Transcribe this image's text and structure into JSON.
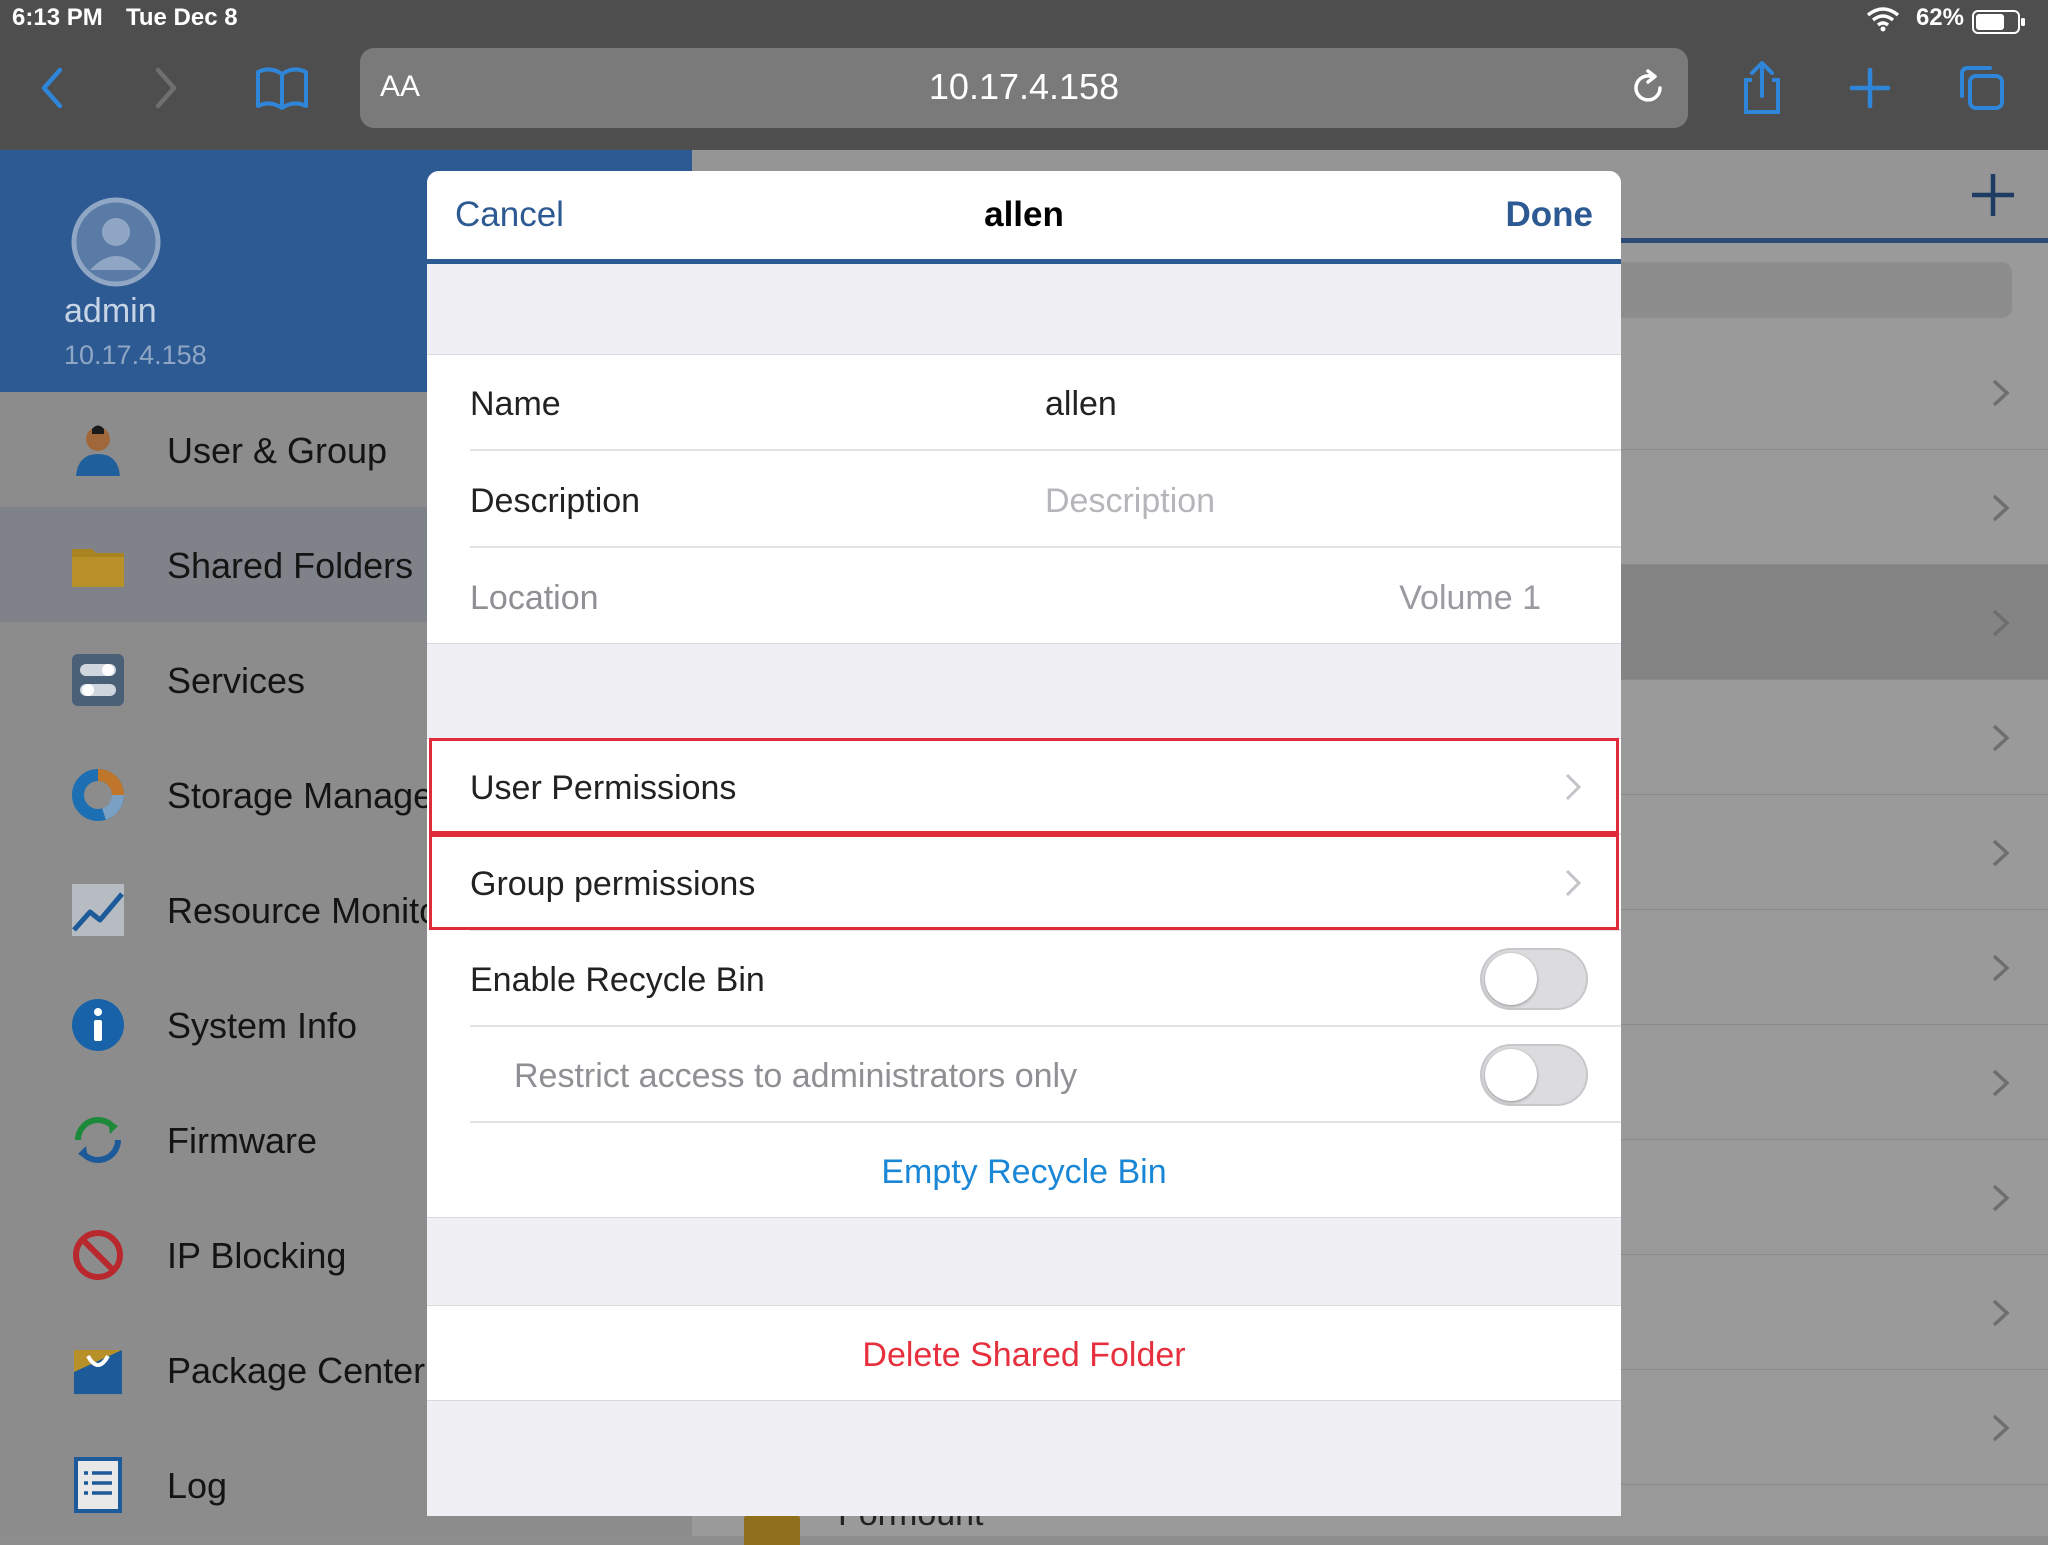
{
  "status_bar": {
    "time": "6:13 PM",
    "date": "Tue Dec 8",
    "battery": "62%"
  },
  "browser": {
    "aa_label": "AA",
    "url": "10.17.4.158"
  },
  "profile": {
    "name": "admin",
    "ip": "10.17.4.158"
  },
  "sidebar": {
    "items": [
      {
        "label": "User & Group",
        "icon": "user-icon"
      },
      {
        "label": "Shared Folders",
        "icon": "folder-icon"
      },
      {
        "label": "Services",
        "icon": "toggles-icon"
      },
      {
        "label": "Storage Manager",
        "icon": "storage-ring-icon"
      },
      {
        "label": "Resource Monitor",
        "icon": "chart-line-icon"
      },
      {
        "label": "System Info",
        "icon": "info-icon"
      },
      {
        "label": "Firmware",
        "icon": "refresh-icon"
      },
      {
        "label": "IP Blocking",
        "icon": "block-icon"
      },
      {
        "label": "Package Center",
        "icon": "package-icon"
      },
      {
        "label": "Log",
        "icon": "log-list-icon"
      }
    ],
    "active_index": 1
  },
  "right_list": {
    "last_item": "Formount"
  },
  "modal": {
    "cancel": "Cancel",
    "title": "allen",
    "done": "Done",
    "fields": {
      "name_label": "Name",
      "name_value": "allen",
      "description_label": "Description",
      "description_placeholder": "Description",
      "location_label": "Location",
      "location_value": "Volume 1"
    },
    "permissions": {
      "user": "User Permissions",
      "group": "Group permissions"
    },
    "recycle": {
      "enable_label": "Enable Recycle Bin",
      "enable_on": false,
      "restrict_label": "Restrict access to administrators only",
      "restrict_on": false,
      "empty_label": "Empty Recycle Bin"
    },
    "delete_label": "Delete Shared Folder"
  },
  "colors": {
    "accent": "#2d5a93",
    "link": "#1a87d6",
    "danger": "#e6303d",
    "highlight": "#e02b3a"
  }
}
